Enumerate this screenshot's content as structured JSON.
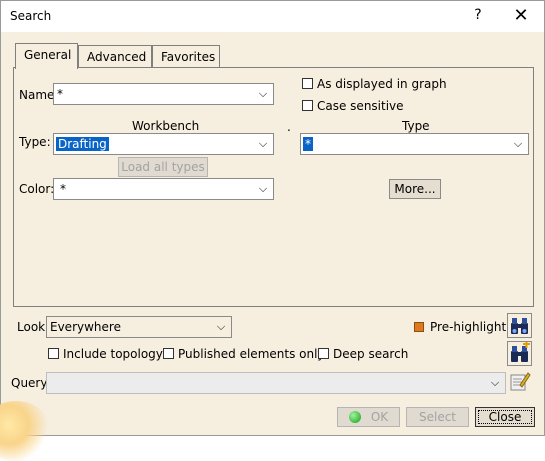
{
  "window": {
    "title": "Search",
    "help_label": "?",
    "close_label": "✕"
  },
  "tabs": [
    {
      "label": "General",
      "active": true
    },
    {
      "label": "Advanced",
      "active": false
    },
    {
      "label": "Favorites",
      "active": false
    }
  ],
  "general": {
    "name_label": "Name:",
    "name_value": "*",
    "workbench_header": "Workbench",
    "type_header": "Type",
    "type_label": "Type:",
    "workbench_value": "Drafting",
    "type_value": "*",
    "load_all_types_label": "Load all types",
    "color_label": "Color:",
    "color_value": "*",
    "as_displayed_label": "As displayed in graph",
    "case_sensitive_label": "Case sensitive",
    "more_label": "More..."
  },
  "look": {
    "label": "Look:",
    "value": "Everywhere",
    "pre_highlight_label": "Pre-highlight",
    "include_topology_label": "Include topology",
    "published_only_label": "Published elements only",
    "deep_search_label": "Deep search"
  },
  "query": {
    "label": "Query:",
    "value": ""
  },
  "footer": {
    "ok_label": "OK",
    "select_label": "Select",
    "close_label": "Close"
  },
  "colors": {
    "accent": "#0a64c8",
    "background": "#f6eedf",
    "prehighlight": "#e07820"
  },
  "icons": [
    "search-icon",
    "search-add-icon",
    "query-edit-icon",
    "chevron-down-icon",
    "ok-status-icon"
  ]
}
